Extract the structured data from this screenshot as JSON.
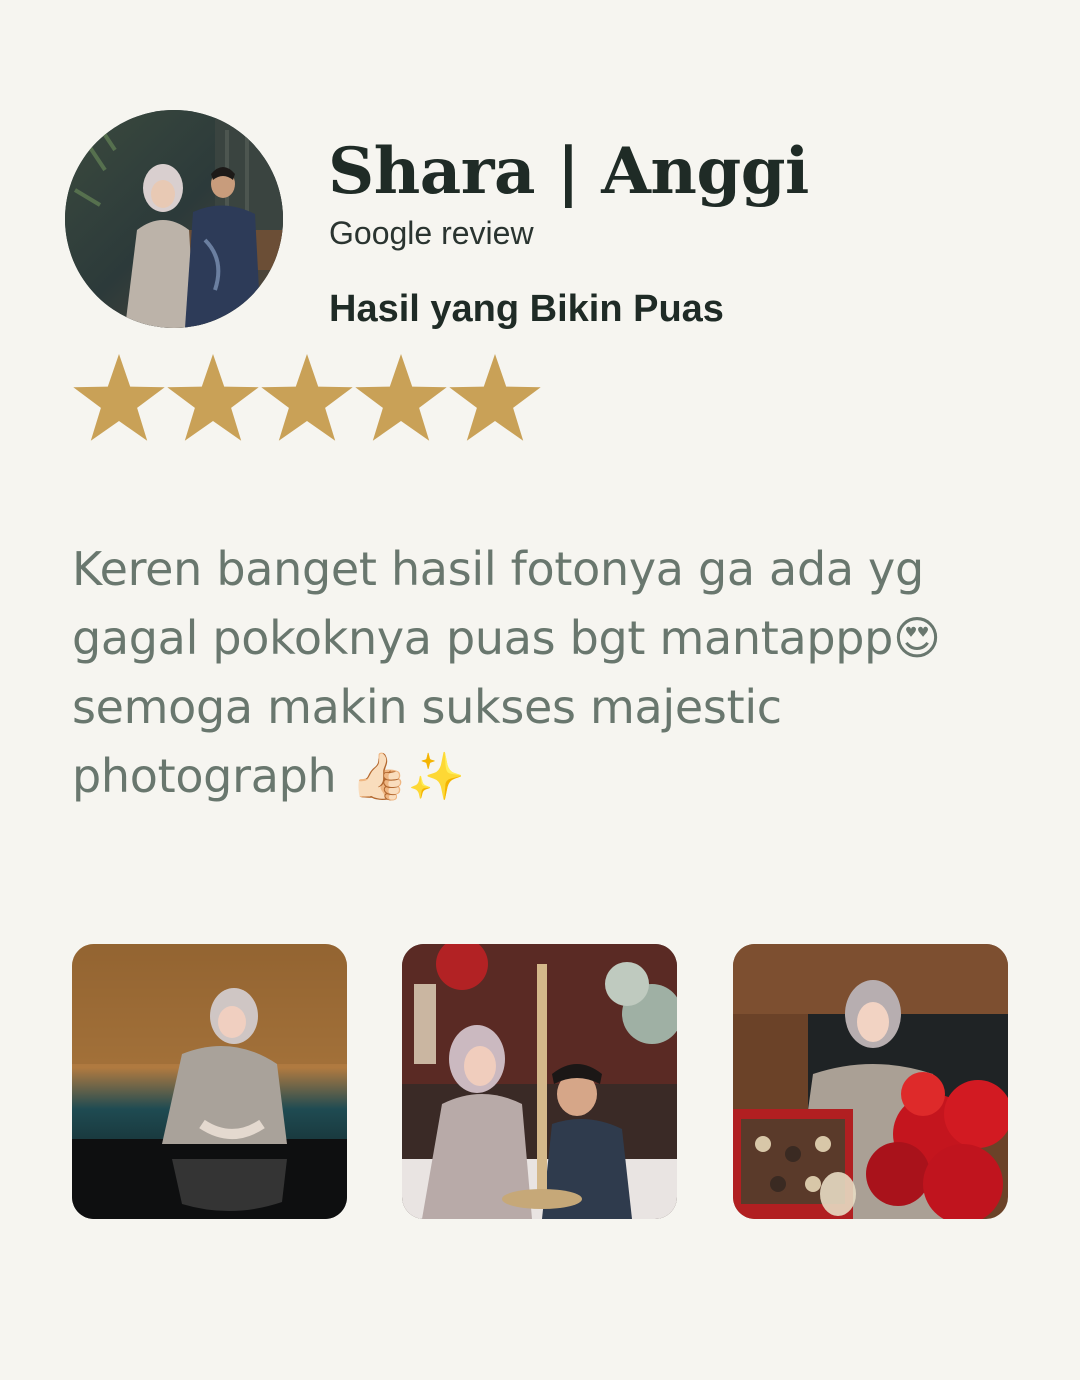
{
  "reviewer": {
    "name": "Shara | Anggi",
    "source": "Google review",
    "avatar_image": "couple-portrait"
  },
  "review": {
    "title": "Hasil yang Bikin Puas",
    "rating": 5,
    "rating_max": 5,
    "star_color": "#c9a157",
    "text": "Keren banget hasil fotonya ga ada yg gagal pokoknya puas bgt mantappp😍 semoga makin sukses majestic photograph 👍🏻✨"
  },
  "photos": [
    {
      "subject": "bride-portrait-table"
    },
    {
      "subject": "couple-candelabra"
    },
    {
      "subject": "bride-red-roses"
    }
  ],
  "colors": {
    "background": "#f6f5f0",
    "heading": "#1f2b26",
    "body_text": "#69776e"
  }
}
